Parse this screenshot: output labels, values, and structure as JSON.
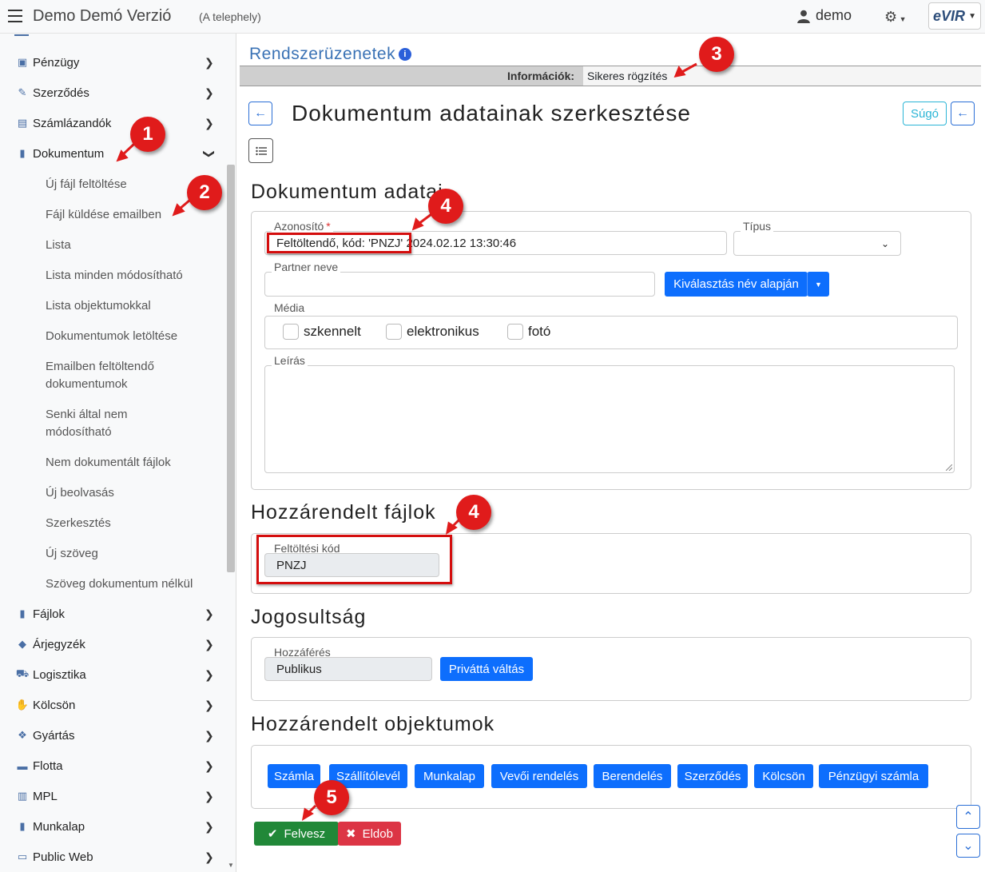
{
  "topbar": {
    "title": "Demo Demó Verzió",
    "subtitle": "(A telephely)",
    "user": "demo",
    "logo": "eVIR"
  },
  "sidebar": {
    "items": [
      {
        "label": "Pénzügy",
        "icon": "money-icon"
      },
      {
        "label": "Szerződés",
        "icon": "contract-icon"
      },
      {
        "label": "Számlázandók",
        "icon": "invoice-icon"
      },
      {
        "label": "Dokumentum",
        "icon": "document-icon"
      },
      {
        "label": "Fájlok",
        "icon": "file-icon"
      },
      {
        "label": "Árjegyzék",
        "icon": "tag-icon"
      },
      {
        "label": "Logisztika",
        "icon": "dolly-icon"
      },
      {
        "label": "Kölcsön",
        "icon": "hand-icon"
      },
      {
        "label": "Gyártás",
        "icon": "cubes-icon"
      },
      {
        "label": "Flotta",
        "icon": "car-icon"
      },
      {
        "label": "MPL",
        "icon": "pallet-icon"
      },
      {
        "label": "Munkalap",
        "icon": "sheet-icon"
      },
      {
        "label": "Public Web",
        "icon": "monitor-icon"
      }
    ],
    "subitems": [
      "Új fájl feltöltése",
      "Fájl küldése emailben",
      "Lista",
      "Lista minden módosítható",
      "Lista objektumokkal",
      "Dokumentumok letöltése",
      "Emailben feltöltendő dokumentumok",
      "Senki által nem módosítható",
      "Nem dokumentált fájlok",
      "Új beolvasás",
      "Szerkesztés",
      "Új szöveg",
      "Szöveg dokumentum nélkül"
    ]
  },
  "messages": {
    "heading": "Rendszerüzenetek",
    "info_label": "Információk:",
    "info_value": "Sikeres rögzítés"
  },
  "page": {
    "title": "Dokumentum adatainak szerkesztése",
    "help": "Súgó"
  },
  "doc_section": {
    "title": "Dokumentum adatai",
    "id_label": "Azonosító",
    "id_required": "*",
    "id_value": "Feltöltendő, kód: 'PNZJ' 2024.02.12 13:30:46",
    "type_label": "Típus",
    "partner_label": "Partner neve",
    "partner_value": "",
    "select_by_name": "Kiválasztás név alapján",
    "media_label": "Média",
    "media_options": [
      "szkennelt",
      "elektronikus",
      "fotó"
    ],
    "desc_label": "Leírás"
  },
  "files_section": {
    "title": "Hozzárendelt fájlok",
    "code_label": "Feltöltési kód",
    "code_value": "PNZJ"
  },
  "rights_section": {
    "title": "Jogosultság",
    "access_label": "Hozzáférés",
    "access_value": "Publikus",
    "toggle": "Privát­tá váltás"
  },
  "objects_section": {
    "title": "Hozzárendelt objektumok",
    "buttons": [
      "Számla",
      "Szállítólevél",
      "Munkalap",
      "Vevői rendelés",
      "Berendelés",
      "Szerződés",
      "Kölcsön",
      "Pénzügyi számla"
    ]
  },
  "actions": {
    "save": "Felvesz",
    "discard": "Eldob"
  },
  "annotations": [
    "1",
    "2",
    "3",
    "4",
    "4",
    "5"
  ],
  "colors": {
    "primary": "#0d6efd",
    "success": "#218838",
    "danger": "#dc3545",
    "annotation": "#e01b1b",
    "heading_link": "#3a72b5"
  }
}
